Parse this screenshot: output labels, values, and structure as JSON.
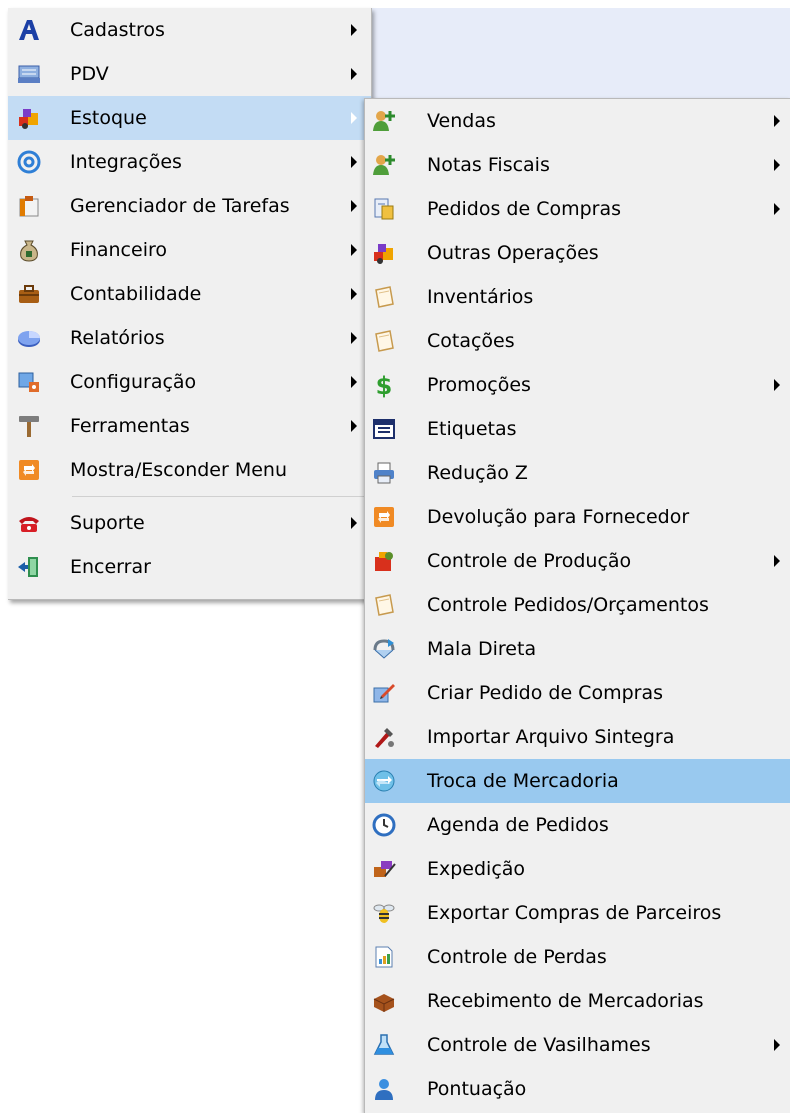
{
  "main_menu": {
    "items": [
      {
        "label": "Cadastros",
        "icon": "font-a-icon",
        "has_submenu": true
      },
      {
        "label": "PDV",
        "icon": "cash-register-icon",
        "has_submenu": true
      },
      {
        "label": "Estoque",
        "icon": "stock-boxes-icon",
        "has_submenu": true,
        "selected": true
      },
      {
        "label": "Integrações",
        "icon": "at-sign-icon",
        "has_submenu": true
      },
      {
        "label": "Gerenciador de Tarefas",
        "icon": "task-manager-icon",
        "has_submenu": true
      },
      {
        "label": "Financeiro",
        "icon": "money-bag-icon",
        "has_submenu": true
      },
      {
        "label": "Contabilidade",
        "icon": "briefcase-icon",
        "has_submenu": true
      },
      {
        "label": "Relatórios",
        "icon": "pie-chart-icon",
        "has_submenu": true
      },
      {
        "label": "Configuração",
        "icon": "configuration-icon",
        "has_submenu": true
      },
      {
        "label": "Ferramentas",
        "icon": "hammer-icon",
        "has_submenu": true
      },
      {
        "label": "Mostra/Esconder Menu",
        "icon": "toggle-menu-icon",
        "has_submenu": false
      }
    ],
    "items_after_separator": [
      {
        "label": "Suporte",
        "icon": "telephone-icon",
        "has_submenu": true
      },
      {
        "label": "Encerrar",
        "icon": "exit-door-icon",
        "has_submenu": false
      }
    ]
  },
  "submenu": {
    "items": [
      {
        "label": "Vendas",
        "icon": "users-add-icon",
        "has_submenu": true
      },
      {
        "label": "Notas Fiscais",
        "icon": "users-add-icon",
        "has_submenu": true
      },
      {
        "label": "Pedidos de Compras",
        "icon": "purchase-order-icon",
        "has_submenu": true
      },
      {
        "label": "Outras Operações",
        "icon": "stock-boxes-icon",
        "has_submenu": false
      },
      {
        "label": "Inventários",
        "icon": "note-paper-icon",
        "has_submenu": false
      },
      {
        "label": "Cotações",
        "icon": "note-paper-icon",
        "has_submenu": false
      },
      {
        "label": "Promoções",
        "icon": "dollar-sign-icon",
        "has_submenu": true
      },
      {
        "label": "Etiquetas",
        "icon": "label-table-icon",
        "has_submenu": false
      },
      {
        "label": "Redução Z",
        "icon": "printer-icon",
        "has_submenu": false
      },
      {
        "label": "Devolução para Fornecedor",
        "icon": "return-icon",
        "has_submenu": false
      },
      {
        "label": "Controle de Produção",
        "icon": "production-icon",
        "has_submenu": true
      },
      {
        "label": "Controle Pedidos/Orçamentos",
        "icon": "note-paper-icon",
        "has_submenu": false
      },
      {
        "label": "Mala Direta",
        "icon": "direct-mail-icon",
        "has_submenu": false
      },
      {
        "label": "Criar Pedido de Compras",
        "icon": "create-order-icon",
        "has_submenu": false
      },
      {
        "label": "Importar Arquivo Sintegra",
        "icon": "import-tools-icon",
        "has_submenu": false
      },
      {
        "label": "Troca de Mercadoria",
        "icon": "exchange-icon",
        "has_submenu": false,
        "selected": true
      },
      {
        "label": "Agenda de Pedidos",
        "icon": "clock-icon",
        "has_submenu": false
      },
      {
        "label": "Expedição",
        "icon": "shipping-icon",
        "has_submenu": false
      },
      {
        "label": "Exportar Compras de Parceiros",
        "icon": "bee-icon",
        "has_submenu": false
      },
      {
        "label": "Controle de Perdas",
        "icon": "report-sheet-icon",
        "has_submenu": false
      },
      {
        "label": "Recebimento de Mercadorias",
        "icon": "brick-box-icon",
        "has_submenu": false
      },
      {
        "label": "Controle de Vasilhames",
        "icon": "flask-icon",
        "has_submenu": true
      },
      {
        "label": "Pontuação",
        "icon": "person-icon",
        "has_submenu": false
      }
    ]
  },
  "colors": {
    "menu_background": "#f0f0f0",
    "main_selected": "#c3dcf4",
    "sub_selected": "#99c9ef",
    "desktop_background": "#e7ecf9"
  }
}
